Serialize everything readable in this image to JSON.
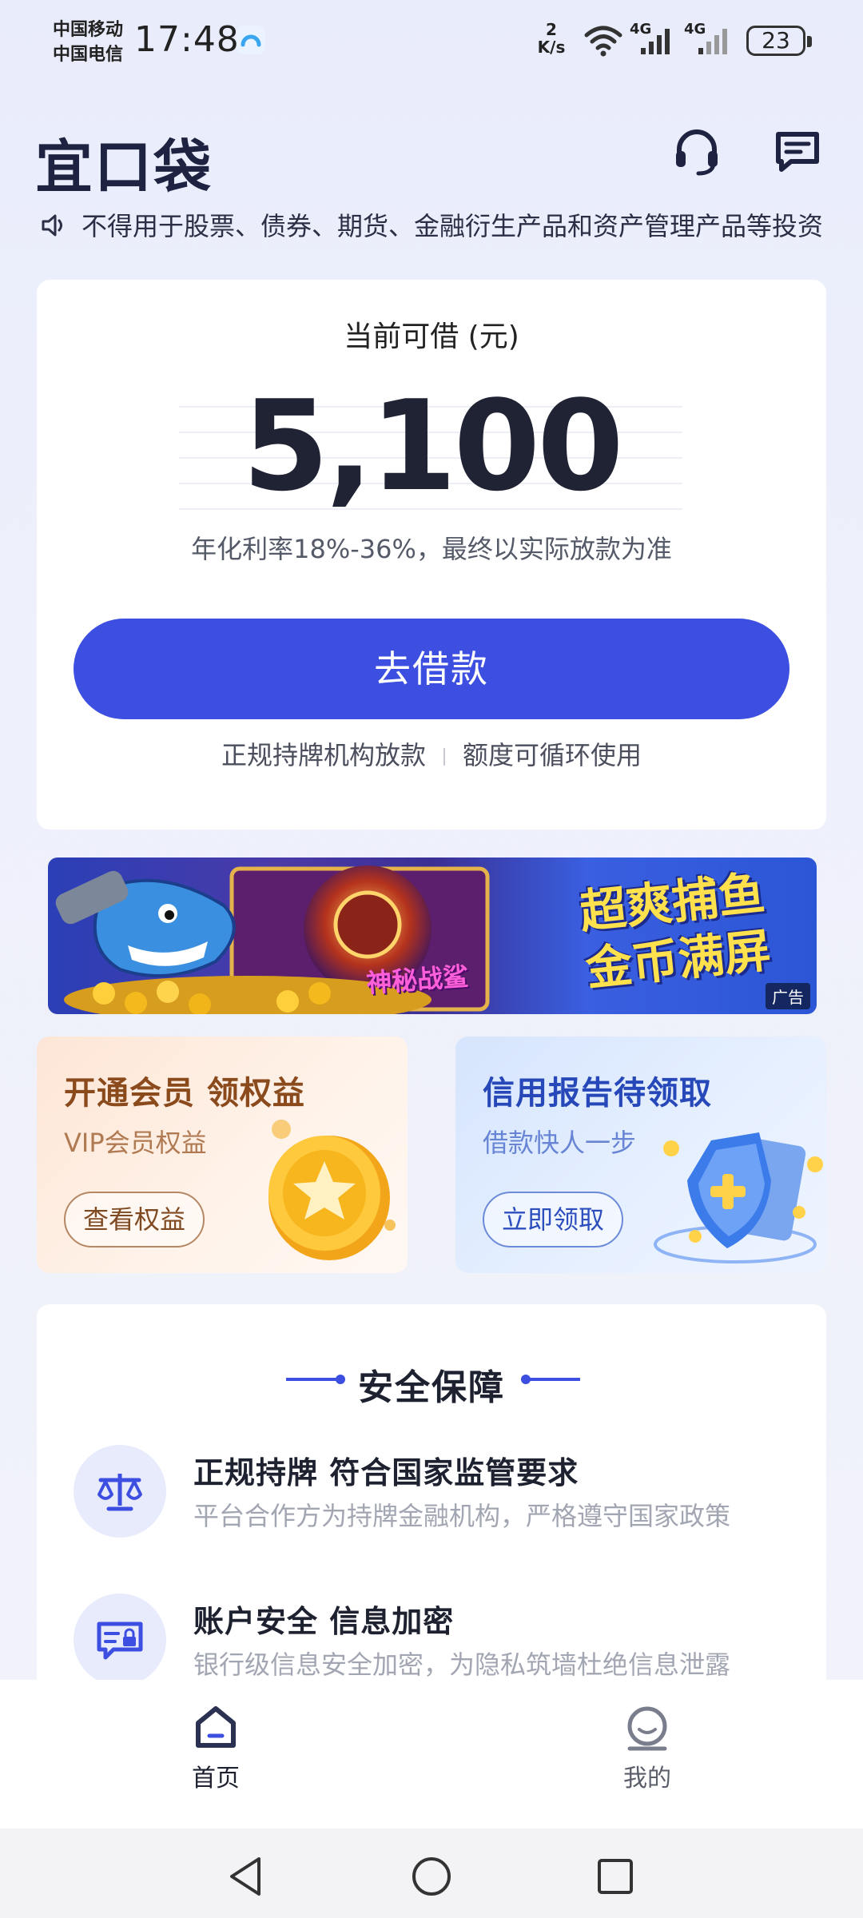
{
  "status_bar": {
    "carrier_1": "中国移动",
    "carrier_2": "中国电信",
    "time": "17:48",
    "net_speed_value": "2",
    "net_speed_unit": "K/s",
    "signal_1_label": "4G",
    "signal_2_label": "4G",
    "battery": "23"
  },
  "header": {
    "logo": "宜口袋",
    "icons": [
      "headset-icon",
      "message-icon"
    ]
  },
  "notice": {
    "text": "不得用于股票、债券、期货、金融衍生产品和资产管理产品等投资"
  },
  "loan_card": {
    "label": "当前可借 (元)",
    "amount": "5,100",
    "rate_note": "年化利率18%-36%，最终以实际放款为准",
    "button": "去借款",
    "tag_1": "正规持牌机构放款",
    "tag_2": "额度可循环使用"
  },
  "ad_banner": {
    "headline_line1": "超爽捕鱼",
    "headline_line2": "金币满屏",
    "game_title": "神秘战鲨",
    "badge": "广告"
  },
  "promos": {
    "vip": {
      "title": "开通会员 领权益",
      "subtitle": "VIP会员权益",
      "button": "查看权益"
    },
    "credit": {
      "title": "信用报告待领取",
      "subtitle": "借款快人一步",
      "button": "立即领取"
    }
  },
  "security": {
    "title": "安全保障",
    "items": [
      {
        "title": "正规持牌 符合国家监管要求",
        "desc": "平台合作方为持牌金融机构，严格遵守国家政策"
      },
      {
        "title": "账户安全 信息加密",
        "desc": "银行级信息安全加密，为隐私筑墙杜绝信息泄露"
      }
    ]
  },
  "bottom_nav": {
    "home": "首页",
    "mine": "我的"
  },
  "colors": {
    "accent": "#3d4fe0",
    "vip_text": "#8a4a1c",
    "credit_text": "#2748b8"
  }
}
